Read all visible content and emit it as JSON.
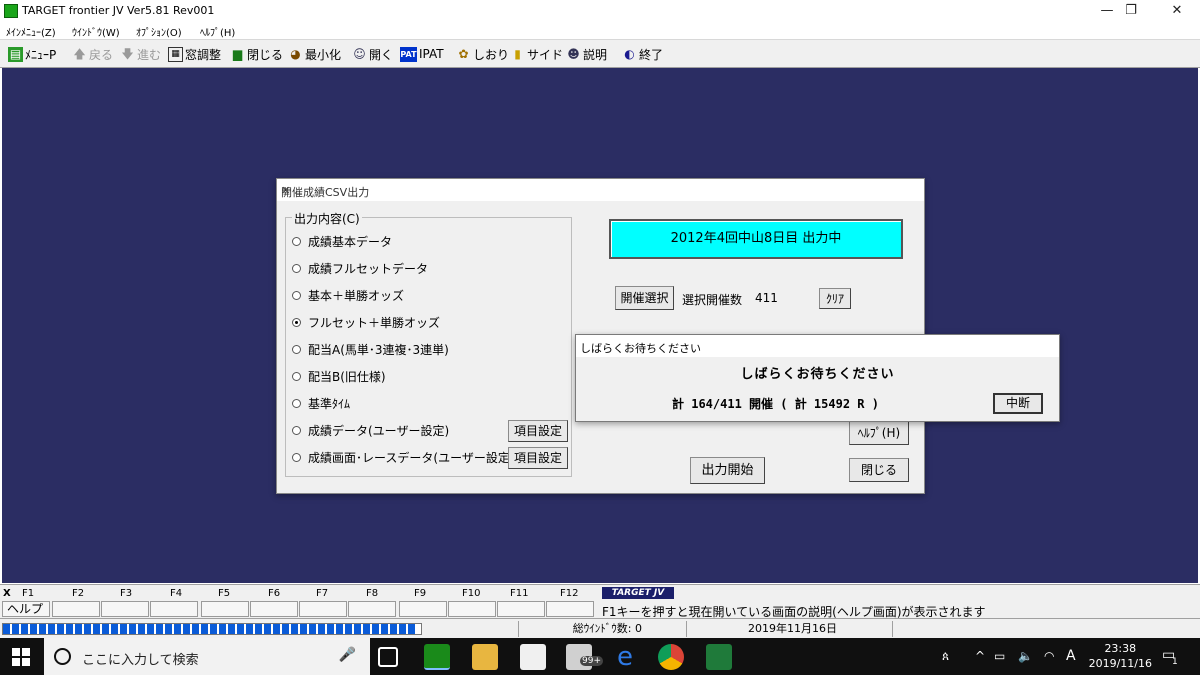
{
  "window": {
    "title": "TARGET frontier JV  Ver5.81  Rev001",
    "controls": {
      "minimize": "—",
      "restore": "❐",
      "close": "✕"
    }
  },
  "menu": [
    "ﾒｲﾝﾒﾆｭｰ(Z)",
    "ｳｲﾝﾄﾞｳ(W)",
    "ｵﾌﾟｼｮﾝ(O)",
    "ﾍﾙﾌﾟ(H)"
  ],
  "toolbar": {
    "menu_p": "ﾒﾆｭｰP",
    "back": "戻る",
    "forward": "進む",
    "arrange": "窓調整",
    "close": "閉じる",
    "minimize": "最小化",
    "open": "開く",
    "ipat_badge": "PAT",
    "ipat": "IPAT",
    "bookmark": "しおり",
    "side": "サイド",
    "explain": "説明",
    "exit": "終了"
  },
  "dialog": {
    "title": "開催成績CSV出力",
    "close_glyph": "✕",
    "group_label": "出力内容(C)",
    "options": [
      "成績基本データ",
      "成績フルセットデータ",
      "基本＋単勝オッズ",
      "フルセット＋単勝オッズ",
      "配当A(馬単･3連複･3連単)",
      "配当B(旧仕様)",
      "基準ﾀｲﾑ",
      "成績データ(ユーザー設定)",
      "成績画面･レースデータ(ユーザー設定)"
    ],
    "selected_option": "フルセット＋単勝オッズ",
    "item_setting": "項目設定",
    "status": "2012年4回中山8日目 出力中",
    "select_meeting": "開催選択",
    "selected_count_label": "選択開催数",
    "selected_count": "411",
    "clear": "ｸﾘｱ",
    "help": "ﾍﾙﾌﾟ(H)",
    "start": "出力開始",
    "close_btn": "閉じる"
  },
  "progress_popup": {
    "title": "しばらくお待ちください",
    "message": "しばらくお待ちください",
    "count": "計 164/411 開催 ( 計 15492 R )",
    "abort": "中断"
  },
  "fkeys": {
    "close_mark": "X",
    "labels": [
      "F1",
      "F2",
      "F3",
      "F4",
      "F5",
      "F6",
      "F7",
      "F8",
      "F9",
      "F10",
      "F11",
      "F12"
    ],
    "f1_button": "ヘルプ",
    "brand": "TARGET JV",
    "help_text": "F1キーを押すと現在開いている画面の説明(ヘルプ画面)が表示されます"
  },
  "statusbar": {
    "progress_fraction": 0.99,
    "windows": "総ｳｲﾝﾄﾞｳ数: 0",
    "date": "2019年11月16日"
  },
  "taskbar": {
    "search_placeholder": "ここに入力して検索",
    "mail_badge": "99+",
    "ime": "A",
    "time": "23:38",
    "date": "2019/11/16",
    "notifications": "1"
  },
  "colors": {
    "workspace": "#2b2d63",
    "status_box": "#00ffff",
    "progress": "#0a5bd8",
    "taskbar": "#101010"
  }
}
